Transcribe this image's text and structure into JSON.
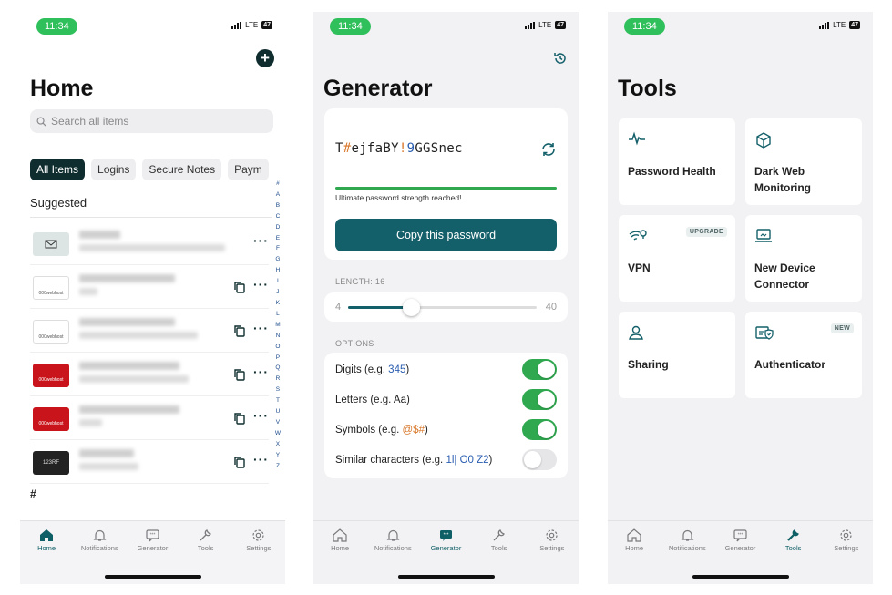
{
  "status": {
    "time": "11:34",
    "network": "LTE",
    "battery": "47"
  },
  "home": {
    "title": "Home",
    "search_placeholder": "Search all items",
    "chips": [
      "All Items",
      "Logins",
      "Secure Notes",
      "Paym"
    ],
    "section": "Suggested",
    "alphabet": [
      "#",
      "A",
      "B",
      "C",
      "D",
      "E",
      "F",
      "G",
      "H",
      "I",
      "J",
      "K",
      "L",
      "M",
      "N",
      "O",
      "P",
      "Q",
      "R",
      "S",
      "T",
      "U",
      "V",
      "W",
      "X",
      "Y",
      "Z"
    ],
    "footer_index": "#",
    "thumb_labels": [
      "000webhost",
      "000webhost",
      "000webhost",
      "000webhost",
      "123RF"
    ]
  },
  "generator": {
    "title": "Generator",
    "password": {
      "p1": "T",
      "s1": "#",
      "p2": "ejfaBY",
      "s2": "!",
      "d1": "9",
      "p3": "GGSnec"
    },
    "strength_label": "Ultimate password strength reached!",
    "copy_button": "Copy this password",
    "length_label": "LENGTH: 16",
    "length": {
      "min": "4",
      "max": "40",
      "value": 16,
      "range_min": 4,
      "range_max": 40
    },
    "options_label": "OPTIONS",
    "options": [
      {
        "prefix": "Digits (e.g. ",
        "sample": "345",
        "suffix": ")",
        "on": true
      },
      {
        "prefix": "Letters (e.g. Aa)",
        "sample": "",
        "suffix": "",
        "on": true
      },
      {
        "prefix": "Symbols (e.g. ",
        "sample": "@$#",
        "suffix": ")",
        "on": true
      },
      {
        "prefix": "Similar characters (e.g. ",
        "sample": "1l| O0 Z2",
        "suffix": ")",
        "on": false
      }
    ]
  },
  "tools": {
    "title": "Tools",
    "tiles": [
      {
        "label": "Password Health",
        "icon": "pulse-icon",
        "badge": ""
      },
      {
        "label": "Dark Web Monitoring",
        "icon": "cube-icon",
        "badge": ""
      },
      {
        "label": "VPN",
        "icon": "wifi-pin-icon",
        "badge": "UPGRADE"
      },
      {
        "label": "New Device Connector",
        "icon": "laptop-icon",
        "badge": ""
      },
      {
        "label": "Sharing",
        "icon": "people-icon",
        "badge": ""
      },
      {
        "label": "Authenticator",
        "icon": "shield-check-icon",
        "badge": "NEW"
      }
    ]
  },
  "tabbar": {
    "items": [
      "Home",
      "Notifications",
      "Generator",
      "Tools",
      "Settings"
    ]
  },
  "colors": {
    "accent": "#14606a",
    "toggle_on": "#2fa84f",
    "status_pill": "#2fbf5b",
    "dark": "#0f2d2e"
  }
}
